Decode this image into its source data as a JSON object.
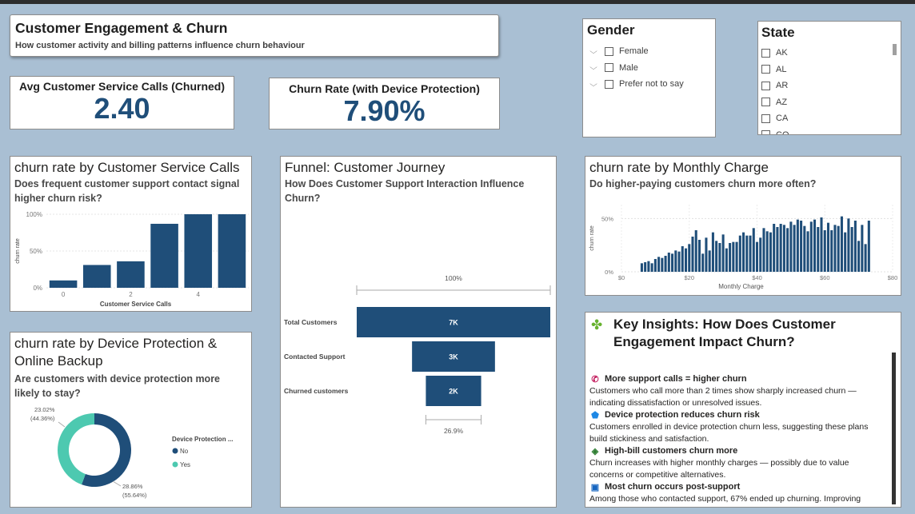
{
  "header": {
    "title": "Customer Engagement & Churn",
    "subtitle": "How customer activity and billing patterns influence churn behaviour"
  },
  "kpis": [
    {
      "label": "Avg Customer Service Calls (Churned)",
      "value": "2.40"
    },
    {
      "label": "Churn Rate (with Device Protection)",
      "value": "7.90%"
    }
  ],
  "slicers": {
    "gender": {
      "title": "Gender",
      "options": [
        "Female",
        "Male",
        "Prefer not to say"
      ]
    },
    "state": {
      "title": "State",
      "options": [
        "AK",
        "AL",
        "AR",
        "AZ",
        "CA",
        "CO"
      ]
    }
  },
  "colors": {
    "primary": "#1f4e79",
    "secondary": "#4dc9b0",
    "background": "#a9bfd3"
  },
  "visuals": {
    "calls": {
      "title": "churn rate by Customer Service Calls",
      "subtitle": "Does frequent customer support contact signal higher churn risk?"
    },
    "funnel": {
      "title": "Funnel: Customer Journey",
      "subtitle": "How Does Customer Support Interaction Influence Churn?"
    },
    "monthly": {
      "title": "churn rate by Monthly Charge",
      "subtitle": "Do higher-paying customers churn more often?"
    },
    "device": {
      "title": "churn rate by Device Protection & Online Backup",
      "subtitle": "Are customers with device protection more likely to stay?"
    }
  },
  "insights": {
    "icon": "puzzle-icon",
    "title": "Key Insights: How Does Customer Engagement Impact Churn?",
    "items": [
      {
        "icon": "phone-icon",
        "glyph": "📞",
        "head": "More support calls = higher churn",
        "body": "Customers who call more than 2 times show sharply increased churn — indicating dissatisfaction or unresolved issues."
      },
      {
        "icon": "shield-icon",
        "glyph": "🛡",
        "head": "Device protection reduces churn risk",
        "body": "Customers enrolled in device protection churn less, suggesting these plans build stickiness and satisfaction."
      },
      {
        "icon": "money-icon",
        "glyph": "💸",
        "head": "High-bill customers churn more",
        "body": "Churn increases with higher monthly charges — possibly due to value concerns or competitive alternatives."
      },
      {
        "icon": "chat-icon",
        "glyph": "💬",
        "head": "Most churn occurs post-support",
        "body": "Among those who contacted support, 67% ended up churning. Improving"
      }
    ]
  },
  "chart_data": [
    {
      "type": "bar",
      "x": [
        0,
        1,
        2,
        3,
        4,
        5
      ],
      "values": [
        0.1,
        0.31,
        0.36,
        0.87,
        1.0,
        1.0
      ],
      "xlabel": "Customer Service Calls",
      "ylabel": "churn rate",
      "xticks": [
        "0",
        "2",
        "4"
      ],
      "yticks": [
        "0%",
        "50%",
        "100%"
      ],
      "ylim": [
        0,
        1
      ],
      "color": "#1f4e79"
    },
    {
      "type": "funnel",
      "stages": [
        "Total Customers",
        "Contacted Support",
        "Churned customers"
      ],
      "values": [
        7000,
        3000,
        2000
      ],
      "labels": [
        "7K",
        "3K",
        "2K"
      ],
      "top_pct": "100%",
      "bottom_pct": "26.9%",
      "color": "#1f4e79"
    },
    {
      "type": "bar",
      "xlabel": "Monthly Charge",
      "ylabel": "churn rate",
      "xticks": [
        "$0",
        "$20",
        "$40",
        "$60",
        "$80"
      ],
      "yticks": [
        "0%",
        "50%"
      ],
      "xlim": [
        0,
        80
      ],
      "ylim": [
        0,
        0.63
      ],
      "x": [
        6,
        7,
        8,
        9,
        10,
        11,
        12,
        13,
        14,
        15,
        16,
        17,
        18,
        19,
        20,
        21,
        22,
        23,
        24,
        25,
        26,
        27,
        28,
        29,
        30,
        31,
        32,
        33,
        34,
        35,
        36,
        37,
        38,
        39,
        40,
        41,
        42,
        43,
        44,
        45,
        46,
        47,
        48,
        49,
        50,
        51,
        52,
        53,
        54,
        55,
        56,
        57,
        58,
        59,
        60,
        61,
        62,
        63,
        64,
        65,
        66,
        67,
        68,
        69,
        70,
        71,
        72,
        73
      ],
      "values": [
        0.08,
        0.09,
        0.1,
        0.08,
        0.12,
        0.14,
        0.13,
        0.15,
        0.18,
        0.17,
        0.2,
        0.19,
        0.24,
        0.22,
        0.26,
        0.33,
        0.39,
        0.3,
        0.17,
        0.32,
        0.2,
        0.37,
        0.29,
        0.27,
        0.35,
        0.22,
        0.27,
        0.28,
        0.28,
        0.34,
        0.37,
        0.34,
        0.34,
        0.41,
        0.28,
        0.32,
        0.41,
        0.38,
        0.37,
        0.45,
        0.42,
        0.45,
        0.44,
        0.41,
        0.47,
        0.44,
        0.49,
        0.48,
        0.43,
        0.38,
        0.47,
        0.49,
        0.42,
        0.51,
        0.39,
        0.46,
        0.39,
        0.44,
        0.43,
        0.52,
        0.37,
        0.5,
        0.42,
        0.48,
        0.29,
        0.44,
        0.26,
        0.48
      ],
      "color": "#1f4e79"
    },
    {
      "type": "pie",
      "donut": true,
      "legend_title": "Device Protection ...",
      "slices": [
        {
          "name": "No",
          "value": 55.64,
          "label_top": "28.86%",
          "label_bottom": "(55.64%)",
          "color": "#1f4e79"
        },
        {
          "name": "Yes",
          "value": 44.36,
          "label_top": "23.02%",
          "label_bottom": "(44.36%)",
          "color": "#4dc9b0"
        }
      ],
      "legend_placement": "right"
    }
  ]
}
